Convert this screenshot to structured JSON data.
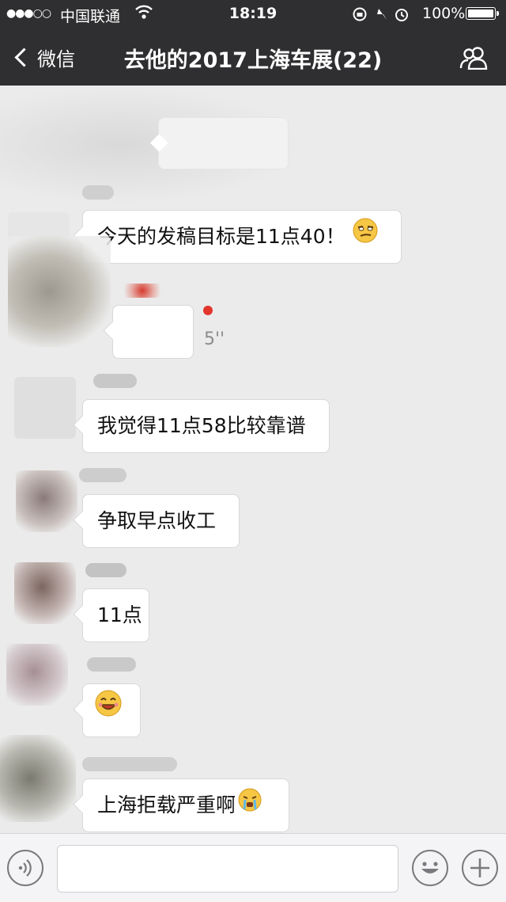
{
  "status_bar": {
    "signal": "●●●○○",
    "carrier": "中国联通",
    "time": "18:19",
    "battery": "100%"
  },
  "nav": {
    "back_label": "微信",
    "title": "去他的2017上海车展(22)",
    "members_icon": "people-icon"
  },
  "messages": [
    {
      "type": "text",
      "text": "今天的发稿目标是11点40！",
      "emoji": "smirk-emoji"
    },
    {
      "type": "voice",
      "duration": "5''",
      "unread": true
    },
    {
      "type": "text",
      "text": "我觉得11点58比较靠谱"
    },
    {
      "type": "text",
      "text": "争取早点收工"
    },
    {
      "type": "text",
      "text": "11点"
    },
    {
      "type": "emoji",
      "emoji": "grin-emoji"
    },
    {
      "type": "text",
      "text": "上海拒载严重啊",
      "emoji": "crying-emoji"
    }
  ],
  "input_bar": {
    "voice_icon": "voice-icon",
    "emoji_icon": "emoji-icon",
    "plus_icon": "plus-icon"
  }
}
